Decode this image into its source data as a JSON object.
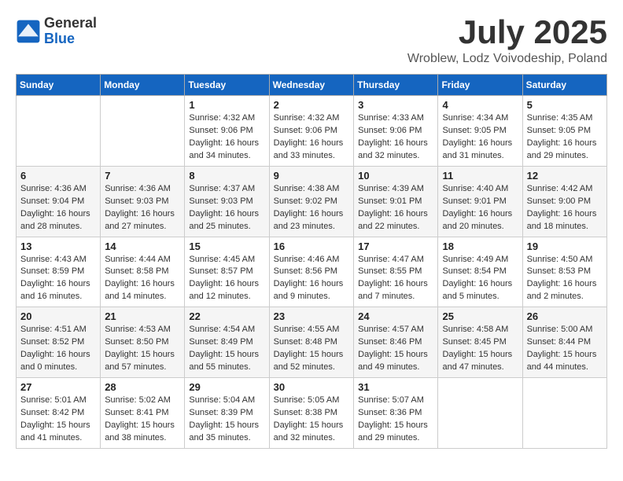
{
  "header": {
    "logo_general": "General",
    "logo_blue": "Blue",
    "month": "July 2025",
    "location": "Wroblew, Lodz Voivodeship, Poland"
  },
  "weekdays": [
    "Sunday",
    "Monday",
    "Tuesday",
    "Wednesday",
    "Thursday",
    "Friday",
    "Saturday"
  ],
  "weeks": [
    [
      {
        "day": "",
        "content": ""
      },
      {
        "day": "",
        "content": ""
      },
      {
        "day": "1",
        "content": "Sunrise: 4:32 AM\nSunset: 9:06 PM\nDaylight: 16 hours\nand 34 minutes."
      },
      {
        "day": "2",
        "content": "Sunrise: 4:32 AM\nSunset: 9:06 PM\nDaylight: 16 hours\nand 33 minutes."
      },
      {
        "day": "3",
        "content": "Sunrise: 4:33 AM\nSunset: 9:06 PM\nDaylight: 16 hours\nand 32 minutes."
      },
      {
        "day": "4",
        "content": "Sunrise: 4:34 AM\nSunset: 9:05 PM\nDaylight: 16 hours\nand 31 minutes."
      },
      {
        "day": "5",
        "content": "Sunrise: 4:35 AM\nSunset: 9:05 PM\nDaylight: 16 hours\nand 29 minutes."
      }
    ],
    [
      {
        "day": "6",
        "content": "Sunrise: 4:36 AM\nSunset: 9:04 PM\nDaylight: 16 hours\nand 28 minutes."
      },
      {
        "day": "7",
        "content": "Sunrise: 4:36 AM\nSunset: 9:03 PM\nDaylight: 16 hours\nand 27 minutes."
      },
      {
        "day": "8",
        "content": "Sunrise: 4:37 AM\nSunset: 9:03 PM\nDaylight: 16 hours\nand 25 minutes."
      },
      {
        "day": "9",
        "content": "Sunrise: 4:38 AM\nSunset: 9:02 PM\nDaylight: 16 hours\nand 23 minutes."
      },
      {
        "day": "10",
        "content": "Sunrise: 4:39 AM\nSunset: 9:01 PM\nDaylight: 16 hours\nand 22 minutes."
      },
      {
        "day": "11",
        "content": "Sunrise: 4:40 AM\nSunset: 9:01 PM\nDaylight: 16 hours\nand 20 minutes."
      },
      {
        "day": "12",
        "content": "Sunrise: 4:42 AM\nSunset: 9:00 PM\nDaylight: 16 hours\nand 18 minutes."
      }
    ],
    [
      {
        "day": "13",
        "content": "Sunrise: 4:43 AM\nSunset: 8:59 PM\nDaylight: 16 hours\nand 16 minutes."
      },
      {
        "day": "14",
        "content": "Sunrise: 4:44 AM\nSunset: 8:58 PM\nDaylight: 16 hours\nand 14 minutes."
      },
      {
        "day": "15",
        "content": "Sunrise: 4:45 AM\nSunset: 8:57 PM\nDaylight: 16 hours\nand 12 minutes."
      },
      {
        "day": "16",
        "content": "Sunrise: 4:46 AM\nSunset: 8:56 PM\nDaylight: 16 hours\nand 9 minutes."
      },
      {
        "day": "17",
        "content": "Sunrise: 4:47 AM\nSunset: 8:55 PM\nDaylight: 16 hours\nand 7 minutes."
      },
      {
        "day": "18",
        "content": "Sunrise: 4:49 AM\nSunset: 8:54 PM\nDaylight: 16 hours\nand 5 minutes."
      },
      {
        "day": "19",
        "content": "Sunrise: 4:50 AM\nSunset: 8:53 PM\nDaylight: 16 hours\nand 2 minutes."
      }
    ],
    [
      {
        "day": "20",
        "content": "Sunrise: 4:51 AM\nSunset: 8:52 PM\nDaylight: 16 hours\nand 0 minutes."
      },
      {
        "day": "21",
        "content": "Sunrise: 4:53 AM\nSunset: 8:50 PM\nDaylight: 15 hours\nand 57 minutes."
      },
      {
        "day": "22",
        "content": "Sunrise: 4:54 AM\nSunset: 8:49 PM\nDaylight: 15 hours\nand 55 minutes."
      },
      {
        "day": "23",
        "content": "Sunrise: 4:55 AM\nSunset: 8:48 PM\nDaylight: 15 hours\nand 52 minutes."
      },
      {
        "day": "24",
        "content": "Sunrise: 4:57 AM\nSunset: 8:46 PM\nDaylight: 15 hours\nand 49 minutes."
      },
      {
        "day": "25",
        "content": "Sunrise: 4:58 AM\nSunset: 8:45 PM\nDaylight: 15 hours\nand 47 minutes."
      },
      {
        "day": "26",
        "content": "Sunrise: 5:00 AM\nSunset: 8:44 PM\nDaylight: 15 hours\nand 44 minutes."
      }
    ],
    [
      {
        "day": "27",
        "content": "Sunrise: 5:01 AM\nSunset: 8:42 PM\nDaylight: 15 hours\nand 41 minutes."
      },
      {
        "day": "28",
        "content": "Sunrise: 5:02 AM\nSunset: 8:41 PM\nDaylight: 15 hours\nand 38 minutes."
      },
      {
        "day": "29",
        "content": "Sunrise: 5:04 AM\nSunset: 8:39 PM\nDaylight: 15 hours\nand 35 minutes."
      },
      {
        "day": "30",
        "content": "Sunrise: 5:05 AM\nSunset: 8:38 PM\nDaylight: 15 hours\nand 32 minutes."
      },
      {
        "day": "31",
        "content": "Sunrise: 5:07 AM\nSunset: 8:36 PM\nDaylight: 15 hours\nand 29 minutes."
      },
      {
        "day": "",
        "content": ""
      },
      {
        "day": "",
        "content": ""
      }
    ]
  ]
}
